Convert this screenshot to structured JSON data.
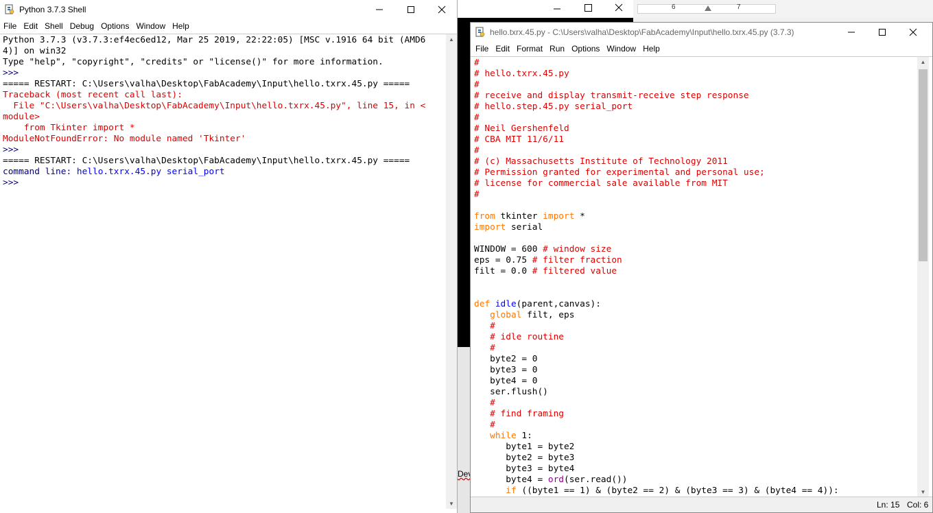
{
  "shell": {
    "title": "Python 3.7.3 Shell",
    "menus": [
      "File",
      "Edit",
      "Shell",
      "Debug",
      "Options",
      "Window",
      "Help"
    ],
    "lines": [
      [
        {
          "t": "Python 3.7.3 (v3.7.3:ef4ec6ed12, Mar 25 2019, 22:22:05) [MSC v.1916 64 bit (AMD6",
          "c": "black"
        }
      ],
      [
        {
          "t": "4)] on win32",
          "c": "black"
        }
      ],
      [
        {
          "t": "Type \"help\", \"copyright\", \"credits\" or \"license()\" for more information.",
          "c": "black"
        }
      ],
      [
        {
          "t": ">>> ",
          "c": "navy"
        }
      ],
      [
        {
          "t": "===== RESTART: C:\\Users\\valha\\Desktop\\FabAcademy\\Input\\hello.txrx.45.py =====",
          "c": "black"
        }
      ],
      [
        {
          "t": "Traceback (most recent call last):",
          "c": "red"
        }
      ],
      [
        {
          "t": "  File \"C:\\Users\\valha\\Desktop\\FabAcademy\\Input\\hello.txrx.45.py\", line 15, in <",
          "c": "red"
        }
      ],
      [
        {
          "t": "module>",
          "c": "red"
        }
      ],
      [
        {
          "t": "    from Tkinter import *",
          "c": "red"
        }
      ],
      [
        {
          "t": "ModuleNotFoundError: No module named 'Tkinter'",
          "c": "red"
        }
      ],
      [
        {
          "t": ">>> ",
          "c": "navy"
        }
      ],
      [
        {
          "t": "===== RESTART: C:\\Users\\valha\\Desktop\\FabAcademy\\Input\\hello.txrx.45.py =====",
          "c": "black"
        }
      ],
      [
        {
          "t": "command line: ",
          "c": "navy"
        },
        {
          "t": "hello.txrx.45.py serial_port",
          "c": "blue"
        }
      ],
      [
        {
          "t": ">>> ",
          "c": "navy"
        }
      ]
    ]
  },
  "editor": {
    "title": "hello.txrx.45.py - C:\\Users\\valha\\Desktop\\FabAcademy\\Input\\hello.txrx.45.py (3.7.3)",
    "menus": [
      "File",
      "Edit",
      "Format",
      "Run",
      "Options",
      "Window",
      "Help"
    ],
    "status": {
      "ln": "Ln: 15",
      "col": "Col: 6"
    },
    "lines": [
      [
        {
          "t": "#",
          "c": "red"
        }
      ],
      [
        {
          "t": "# hello.txrx.45.py",
          "c": "red"
        }
      ],
      [
        {
          "t": "#",
          "c": "red"
        }
      ],
      [
        {
          "t": "# receive and display transmit-receive step response",
          "c": "red"
        }
      ],
      [
        {
          "t": "# hello.step.45.py serial_port",
          "c": "red"
        }
      ],
      [
        {
          "t": "#",
          "c": "red"
        }
      ],
      [
        {
          "t": "# Neil Gershenfeld",
          "c": "red"
        }
      ],
      [
        {
          "t": "# CBA MIT 11/6/11",
          "c": "red"
        }
      ],
      [
        {
          "t": "#",
          "c": "red"
        }
      ],
      [
        {
          "t": "# (c) Massachusetts Institute of Technology 2011",
          "c": "red"
        }
      ],
      [
        {
          "t": "# Permission granted for experimental and personal use;",
          "c": "red"
        }
      ],
      [
        {
          "t": "# license for commercial sale available from MIT",
          "c": "red"
        }
      ],
      [
        {
          "t": "#",
          "c": "red"
        }
      ],
      [],
      [
        {
          "t": "from",
          "c": "kw"
        },
        {
          "t": " tkinter ",
          "c": "black"
        },
        {
          "t": "import",
          "c": "kw"
        },
        {
          "t": " *",
          "c": "black"
        }
      ],
      [
        {
          "t": "import",
          "c": "kw"
        },
        {
          "t": " serial",
          "c": "black"
        }
      ],
      [],
      [
        {
          "t": "WINDOW = 600 ",
          "c": "black"
        },
        {
          "t": "# window size",
          "c": "red"
        }
      ],
      [
        {
          "t": "eps = 0.75 ",
          "c": "black"
        },
        {
          "t": "# filter fraction",
          "c": "red"
        }
      ],
      [
        {
          "t": "filt = 0.0 ",
          "c": "black"
        },
        {
          "t": "# filtered value",
          "c": "red"
        }
      ],
      [],
      [],
      [
        {
          "t": "def",
          "c": "kw"
        },
        {
          "t": " ",
          "c": "black"
        },
        {
          "t": "idle",
          "c": "fn"
        },
        {
          "t": "(parent,canvas):",
          "c": "black"
        }
      ],
      [
        {
          "t": "   ",
          "c": "black"
        },
        {
          "t": "global",
          "c": "kw"
        },
        {
          "t": " filt, eps",
          "c": "black"
        }
      ],
      [
        {
          "t": "   #",
          "c": "red"
        }
      ],
      [
        {
          "t": "   # idle routine",
          "c": "red"
        }
      ],
      [
        {
          "t": "   #",
          "c": "red"
        }
      ],
      [
        {
          "t": "   byte2 = 0",
          "c": "black"
        }
      ],
      [
        {
          "t": "   byte3 = 0",
          "c": "black"
        }
      ],
      [
        {
          "t": "   byte4 = 0",
          "c": "black"
        }
      ],
      [
        {
          "t": "   ser.flush()",
          "c": "black"
        }
      ],
      [
        {
          "t": "   #",
          "c": "red"
        }
      ],
      [
        {
          "t": "   # find framing",
          "c": "red"
        }
      ],
      [
        {
          "t": "   #",
          "c": "red"
        }
      ],
      [
        {
          "t": "   ",
          "c": "black"
        },
        {
          "t": "while",
          "c": "kw"
        },
        {
          "t": " 1:",
          "c": "black"
        }
      ],
      [
        {
          "t": "      byte1 = byte2",
          "c": "black"
        }
      ],
      [
        {
          "t": "      byte2 = byte3",
          "c": "black"
        }
      ],
      [
        {
          "t": "      byte3 = byte4",
          "c": "black"
        }
      ],
      [
        {
          "t": "      byte4 = ",
          "c": "black"
        },
        {
          "t": "ord",
          "c": "bi"
        },
        {
          "t": "(ser.read())",
          "c": "black"
        }
      ],
      [
        {
          "t": "      ",
          "c": "black"
        },
        {
          "t": "if",
          "c": "kw"
        },
        {
          "t": " ((byte1 == 1) & (byte2 == 2) & (byte3 == 3) & (byte4 == 4)):",
          "c": "black"
        }
      ]
    ]
  },
  "background": {
    "ruler_labels": [
      "6",
      "7"
    ],
    "doc_fragment": "Dev"
  }
}
